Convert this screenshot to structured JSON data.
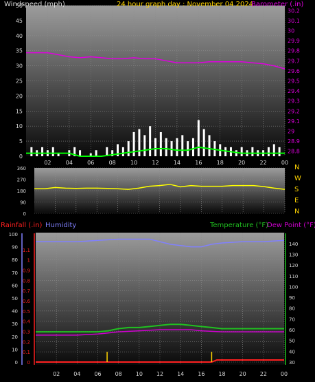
{
  "colors": {
    "background": "#000000",
    "windspeed_label": "#d8d8d8",
    "title": "#ffd400",
    "barometer": "#e000e0",
    "wind_bars": "#ffffff",
    "wind_avg": "#00ff00",
    "direction": "#ffff00",
    "compass_letters": "#ffd400",
    "rainfall_label": "#ff2020",
    "humidity": "#8080ff",
    "temperature": "#20c020",
    "dew_point": "#d000d0",
    "rain_line": "#ff2020",
    "rain_ticks": "#ffd400",
    "grid": "#8c8c8c"
  },
  "chart_data": [
    {
      "type": "line",
      "title": "24 hour graph day : November 04 2024",
      "ylabel": "Windspeed (mph)",
      "y2label": "Barometer (.in)",
      "ylim": [
        0,
        50
      ],
      "y2lim": [
        28.75,
        30.25
      ],
      "yticks": [
        "0",
        "5",
        "10",
        "15",
        "20",
        "25",
        "30",
        "35",
        "40",
        "45",
        "50"
      ],
      "y2ticks": [
        "28.8",
        "28.9",
        "29",
        "29.1",
        "29.2",
        "29.3",
        "29.4",
        "29.5",
        "29.6",
        "29.7",
        "29.8",
        "29.9",
        "30",
        "30.1",
        "30.2"
      ],
      "xticks": [
        "02",
        "04",
        "06",
        "08",
        "10",
        "12",
        "14",
        "16",
        "18",
        "20",
        "22",
        "00"
      ],
      "xlim": [
        0,
        24
      ],
      "grid": true,
      "series": [
        {
          "name": "Windspeed (mph)",
          "type": "bars",
          "x": [
            0.5,
            1,
            1.5,
            2,
            2.5,
            3,
            3.5,
            4,
            4.5,
            5,
            5.5,
            6,
            6.5,
            7,
            7.5,
            8,
            8.5,
            9,
            9.5,
            10,
            10.5,
            11,
            11.5,
            12,
            12.5,
            13,
            13.5,
            14,
            14.5,
            15,
            15.5,
            16,
            16.5,
            17,
            17.5,
            18,
            18.5,
            19,
            19.5,
            20,
            20.5,
            21,
            21.5,
            22,
            22.5,
            23,
            23.5
          ],
          "values": [
            3,
            2,
            3,
            2,
            3,
            1,
            0,
            2,
            3,
            2,
            0,
            1,
            2,
            0,
            3,
            2,
            4,
            3,
            5,
            8,
            9,
            7,
            10,
            6,
            8,
            6,
            5,
            6,
            7,
            5,
            6,
            12,
            9,
            7,
            5,
            4,
            3,
            3,
            2,
            3,
            2,
            3,
            2,
            2,
            3,
            4,
            3
          ]
        },
        {
          "name": "Wind average (mph)",
          "x": [
            0,
            1,
            2,
            3,
            4,
            5,
            6,
            7,
            8,
            9,
            10,
            11,
            12,
            13,
            14,
            15,
            16,
            17,
            18,
            19,
            20,
            21,
            22,
            23,
            24
          ],
          "values": [
            1,
            1,
            1,
            1,
            1,
            0,
            0,
            0,
            0.5,
            1,
            1.5,
            2,
            2.5,
            2.5,
            2,
            2,
            3,
            2.5,
            2,
            1.5,
            1,
            1,
            1,
            1,
            1
          ]
        },
        {
          "name": "Barometer (.in)",
          "axis": "right",
          "x": [
            0,
            1,
            2,
            3,
            4,
            5,
            6,
            7,
            8,
            9,
            10,
            11,
            12,
            13,
            14,
            15,
            16,
            17,
            18,
            19,
            20,
            21,
            22,
            23,
            24
          ],
          "values": [
            29.78,
            29.78,
            29.78,
            29.76,
            29.74,
            29.73,
            29.74,
            29.73,
            29.72,
            29.72,
            29.73,
            29.72,
            29.72,
            29.7,
            29.68,
            29.68,
            29.68,
            29.69,
            29.69,
            29.69,
            29.69,
            29.68,
            29.67,
            29.65,
            29.62
          ]
        }
      ]
    },
    {
      "type": "line",
      "yticks": [
        "0",
        "90",
        "180",
        "270",
        "360"
      ],
      "ylim": [
        0,
        360
      ],
      "y2ticks": [
        "N",
        "W",
        "S",
        "E",
        "N"
      ],
      "xlim": [
        0,
        24
      ],
      "grid": true,
      "series": [
        {
          "name": "Wind direction (deg)",
          "x": [
            0,
            1,
            2,
            3,
            4,
            5,
            6,
            7,
            8,
            9,
            10,
            11,
            12,
            13,
            14,
            15,
            16,
            17,
            18,
            19,
            20,
            21,
            22,
            23,
            24
          ],
          "values": [
            195,
            195,
            205,
            200,
            198,
            200,
            200,
            198,
            195,
            190,
            200,
            215,
            220,
            230,
            210,
            220,
            215,
            215,
            215,
            220,
            220,
            220,
            212,
            200,
            190
          ]
        }
      ]
    },
    {
      "type": "line",
      "ylabel": "Rainfall (.in)",
      "y2label": "Humidity",
      "y3label": "Temperature (°F)",
      "y4label": "Dew Point (°F)",
      "rain_ticks": [
        "0",
        "0.1",
        "0.2",
        "0.3",
        "0.4",
        "0.5",
        "0.6",
        "0.7",
        "0.8",
        "0.9",
        "1",
        "1.1"
      ],
      "rain_lim": [
        0,
        1.2
      ],
      "humidity_ticks": [
        "0",
        "10",
        "20",
        "30",
        "40",
        "50",
        "60",
        "70",
        "80",
        "90",
        "100"
      ],
      "humidity_lim": [
        0,
        100
      ],
      "temp_ticks": [
        "30",
        "40",
        "50",
        "60",
        "70",
        "80",
        "90",
        "100",
        "110",
        "120",
        "130",
        "140"
      ],
      "temp_lim": [
        30,
        145
      ],
      "xticks": [
        "02",
        "04",
        "06",
        "08",
        "10",
        "12",
        "14",
        "16",
        "18",
        "20",
        "22",
        "00"
      ],
      "xlim": [
        0,
        24
      ],
      "grid": true,
      "series": [
        {
          "name": "Humidity",
          "axis": "humidity",
          "x": [
            0,
            2,
            4,
            6,
            8,
            10,
            11,
            12,
            13,
            14,
            15,
            16,
            17,
            18,
            20,
            22,
            24
          ],
          "values": [
            94,
            94,
            94,
            95,
            96,
            96,
            96,
            94,
            92,
            91,
            90,
            90,
            92,
            93,
            94,
            94,
            95
          ]
        },
        {
          "name": "Temperature (°F)",
          "axis": "temp",
          "x": [
            0,
            2,
            4,
            6,
            7,
            8,
            9,
            10,
            11,
            12,
            13,
            14,
            15,
            16,
            17,
            18,
            20,
            22,
            24
          ],
          "values": [
            58,
            58,
            58,
            58,
            59,
            61,
            62,
            62,
            63,
            64,
            65,
            65,
            64,
            63,
            62,
            61,
            61,
            61,
            61
          ]
        },
        {
          "name": "Dew Point (°F)",
          "axis": "temp",
          "x": [
            0,
            2,
            4,
            6,
            7,
            8,
            10,
            12,
            13,
            14,
            15,
            16,
            18,
            20,
            22,
            24
          ],
          "values": [
            55,
            55,
            55,
            56,
            57,
            58,
            59,
            60,
            60,
            60,
            60,
            59,
            58,
            58,
            58,
            58
          ]
        },
        {
          "name": "Rainfall (.in)",
          "axis": "rain",
          "x": [
            0,
            1,
            2,
            3,
            4,
            5,
            6,
            7,
            8,
            9,
            10,
            11,
            12,
            13,
            14,
            15,
            16,
            17,
            17.5,
            18,
            19,
            20,
            21,
            22,
            23,
            24
          ],
          "values": [
            0,
            0,
            0,
            0,
            0,
            0,
            0,
            0,
            0,
            0,
            0,
            0,
            0,
            0,
            0,
            0,
            0,
            0,
            0.02,
            0.02,
            0.02,
            0.02,
            0.02,
            0.02,
            0.02,
            0.02
          ]
        },
        {
          "name": "Rain rate markers",
          "axis": "rain",
          "x": [
            6.9,
            17.0
          ],
          "values": [
            0.1,
            0.1
          ]
        }
      ]
    }
  ]
}
